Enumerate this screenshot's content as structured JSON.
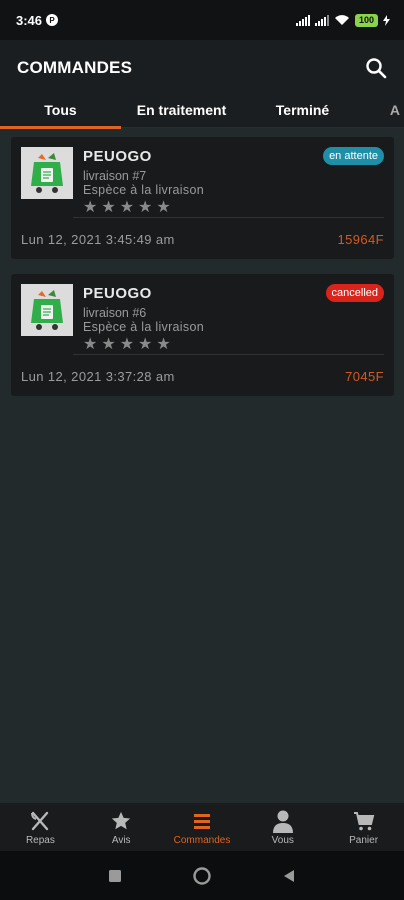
{
  "status_bar": {
    "time": "3:46",
    "battery": "100"
  },
  "app_bar": {
    "title": "COMMANDES",
    "search_icon": "search-icon"
  },
  "tabs": [
    {
      "label": "Tous",
      "active": true
    },
    {
      "label": "En traitement",
      "active": false
    },
    {
      "label": "Terminé",
      "active": false
    },
    {
      "label": "A",
      "active": false
    }
  ],
  "orders": [
    {
      "shop_name": "PEUOGO",
      "delivery": "livraison #7",
      "payment": "Espèce à la livraison",
      "status": "en attente",
      "status_color": "#1e8fa6",
      "rating": 0,
      "date": "Lun 12, 2021 3:45:49 am",
      "price": "15964F"
    },
    {
      "shop_name": "PEUOGO",
      "delivery": "livraison #6",
      "payment": "Espèce à la livraison",
      "status": "cancelled",
      "status_color": "#d9241c",
      "rating": 0,
      "date": "Lun 12, 2021 3:37:28 am",
      "price": "7045F"
    }
  ],
  "bottom_nav": [
    {
      "label": "Repas",
      "icon": "fork-knife-icon",
      "active": false
    },
    {
      "label": "Avis",
      "icon": "star-icon",
      "active": false
    },
    {
      "label": "Commandes",
      "icon": "list-icon",
      "active": true
    },
    {
      "label": "Vous",
      "icon": "person-icon",
      "active": false
    },
    {
      "label": "Panier",
      "icon": "cart-icon",
      "active": false
    }
  ],
  "colors": {
    "accent": "#e0631f",
    "background": "#222a2b",
    "card": "#181a1c",
    "price": "#d35a22"
  }
}
